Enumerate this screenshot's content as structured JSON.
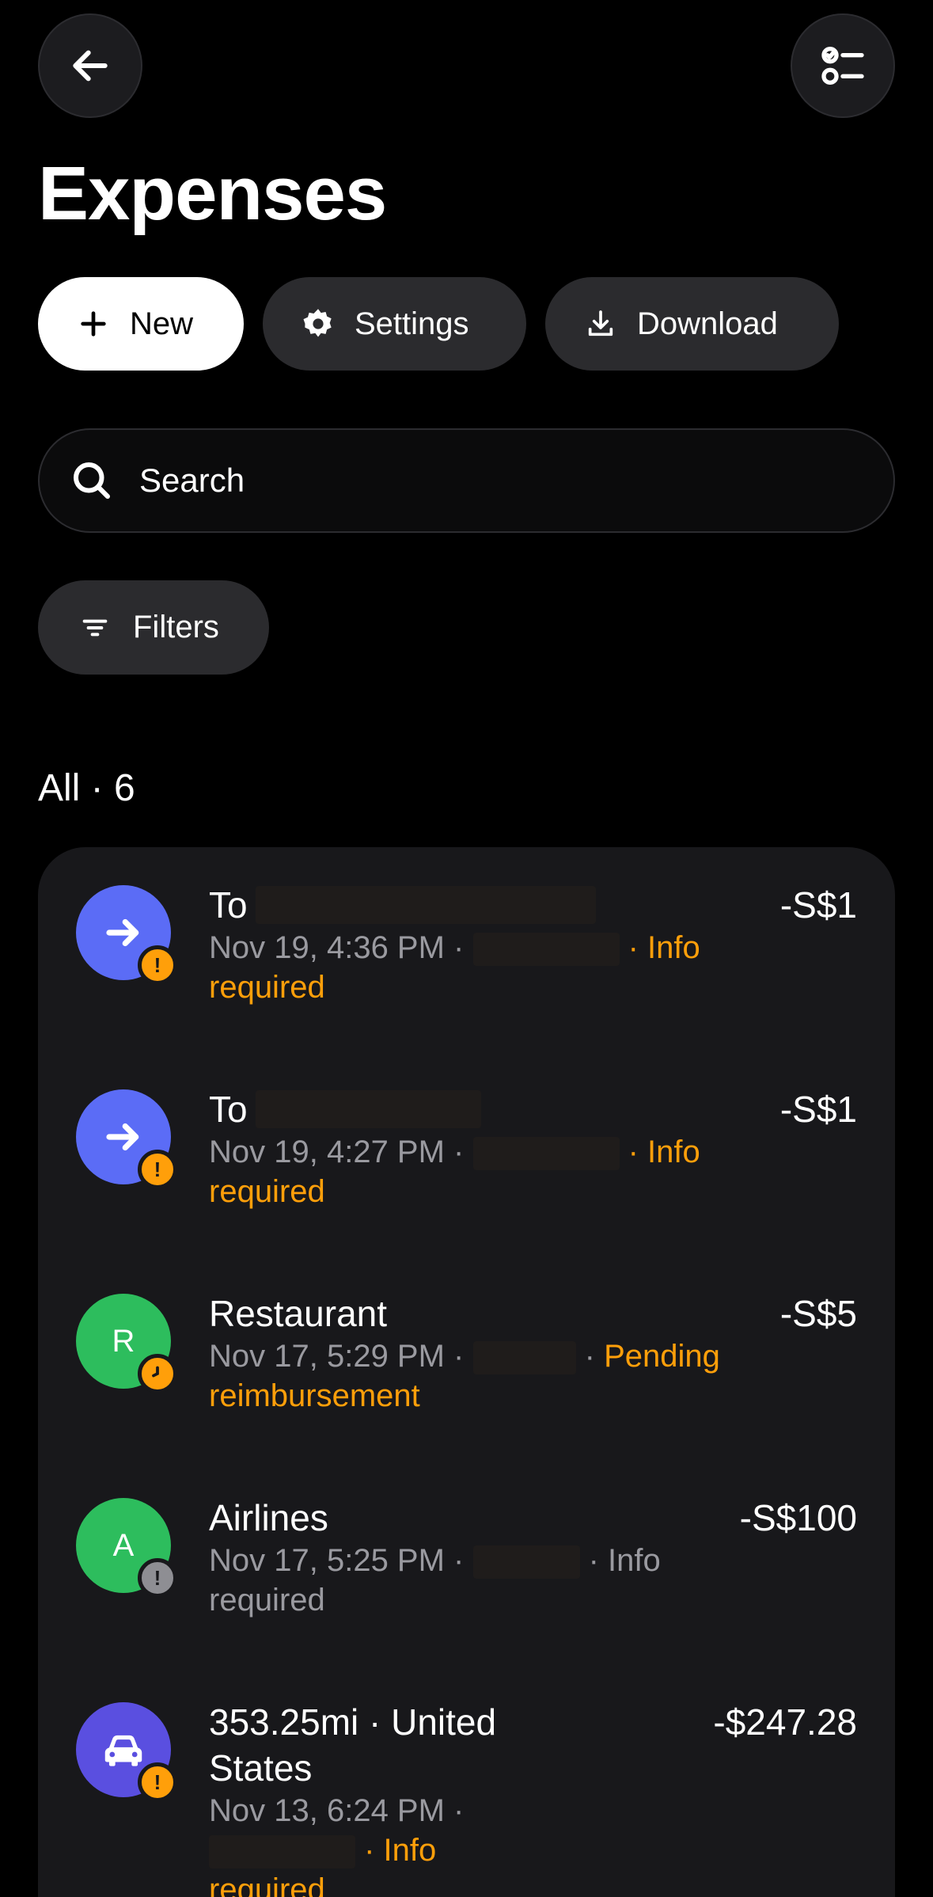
{
  "header": {
    "title": "Expenses"
  },
  "actions": {
    "new_label": "New",
    "settings_label": "Settings",
    "download_label": "Download"
  },
  "search": {
    "placeholder": "Search"
  },
  "filters": {
    "label": "Filters"
  },
  "section": {
    "label": "All · 6"
  },
  "colors": {
    "accent_orange": "#ff9f0a",
    "avatar_blue": "#5b6cf6",
    "avatar_green": "#2dbd5d",
    "avatar_purple": "#5a4fe0",
    "badge_grey": "#8e8e93"
  },
  "transactions": [
    {
      "prefix": "To",
      "date": "Nov 19, 4:36 PM ·",
      "status": "· Info required",
      "amount": "-S$1",
      "icon": "arrow-right-icon",
      "badge": "exclamation-icon"
    },
    {
      "prefix": "To",
      "date": "Nov 19, 4:27 PM ·",
      "status": "· Info required",
      "amount": "-S$1",
      "icon": "arrow-right-icon",
      "badge": "exclamation-icon"
    },
    {
      "title": "Restaurant",
      "initial": "R",
      "date": "Nov 17, 5:29 PM ·",
      "sep": "·",
      "status": "Pending reimbursement",
      "amount": "-S$5",
      "badge": "clock-icon"
    },
    {
      "title": "Airlines",
      "initial": "A",
      "date": "Nov 17, 5:25 PM ·",
      "status": "· Info required",
      "amount": "-S$100",
      "badge": "exclamation-icon"
    },
    {
      "title": "353.25mi · United States",
      "date": "Nov 13, 6:24 PM ·",
      "status": "· Info required",
      "amount": "-$247.28",
      "icon": "car-icon",
      "badge": "exclamation-icon"
    }
  ]
}
